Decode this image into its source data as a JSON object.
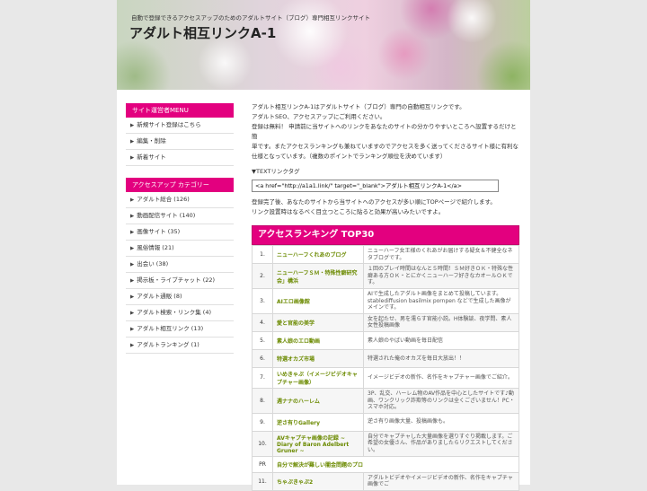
{
  "header": {
    "tagline": "自動で登録できるアクセスアップのためのアダルトサイト（ブログ）専門相互リンクサイト",
    "title": "アダルト相互リンクA-1"
  },
  "admin_menu": {
    "heading": "サイト運営者MENU",
    "items": [
      "新規サイト登録はこちら",
      "編集・削除",
      "新着サイト"
    ]
  },
  "categories": {
    "heading": "アクセスアップ カテゴリー",
    "items": [
      "アダルト総合 (126)",
      "動画配信サイト (140)",
      "画像サイト (35)",
      "風俗情報 (21)",
      "出会い (38)",
      "掲示板・ライブチャット (22)",
      "アダルト通販 (8)",
      "アダルト検索・リンク集 (4)",
      "アダルト相互リンク (13)",
      "アダルトランキング (1)"
    ]
  },
  "main": {
    "intro_lines": [
      "アダルト相互リンクA-1はアダルトサイト（ブログ）専門の自動相互リンクです。",
      "アダルトSEO、アクセスアップにご利用ください。",
      "登録は無料！ 申請前に当サイトへのリンクをあなたのサイトの分かりやすいところへ設置するだけと簡",
      "単です。またアクセスランキングも兼ねていますのでアクセスを多く送ってくださるサイト様に有利な",
      "仕様となっています。（複数のポイントでランキング順位を決めています）"
    ],
    "text_link_label": "▼TEXTリンクタグ",
    "link_code": "<a href=\"http://a1a1.link/\" target=\"_blank\">アダルト相互リンクA-1</a>",
    "after_lines": [
      "登録完了後、あなたのサイトから当サイトへのアクセスが多い順にTOPページで紹介します。",
      "リンク設置時はなるべく目立つところに貼ると効果が高いみたいですよ。"
    ]
  },
  "ranking": {
    "heading": "アクセスランキング TOP30",
    "rows": [
      {
        "num": "1.",
        "site": "ニューハーフくれあのブログ",
        "desc": "ニューハーフ女王様のくれあがお届けする疑女＆不健全なネタブログです。"
      },
      {
        "num": "2.",
        "site": "ニューハーフＳＭ・特殊性癖研究会」構浜",
        "desc": "１回のプレイ時間はなんと５時間！ＳＭ好きＯＫ・特殊な性癖ある方ＯＫ・とにかくニューハーフ好きなカオールＯＫです。"
      },
      {
        "num": "3.",
        "site": "AIエロ画像館",
        "desc": "AIで生成したアダルト画像をまとめて投稿しています。stablediffusion basilmix pornpen などで生成した画像がメインです。"
      },
      {
        "num": "4.",
        "site": "愛と官能の美学",
        "desc": "女を起たせ、男を濡らす官能小説。H体験談、夜学問、素人女性投稿画像"
      },
      {
        "num": "5.",
        "site": "素人娘のエロ動画",
        "desc": "素人娘のやばい動画を毎日配信"
      },
      {
        "num": "6.",
        "site": "特選オカズ市場",
        "desc": "特選された俺のオカズを毎日大放出！！"
      },
      {
        "num": "7.",
        "site": "いめきゃぷ（イメージビデオキャプチャー画像）",
        "desc": "イメージビデオの新作、名作をキャプチャー画像でご紹介。"
      },
      {
        "num": "8.",
        "site": "週ナナのハーレム",
        "desc": "3P、乱交、ハーレム物のAV作品を中心としたサイトです♪動画、ワンクリック詐欺等のリンクは全くございません！PC・スマホ対応。"
      },
      {
        "num": "9.",
        "site": "逆さ有りGallery",
        "desc": "逆さ有り画像大量、投稿画像も。"
      },
      {
        "num": "10.",
        "site": "AVキャプチャ画像の記録 ~ Diary of Baron Adelbert Gruner ~",
        "desc": "自分でキャプチャした大量画像を選りすぐり掲載します。ご希望の女優さん、作品がありましたらリクエストしてください。"
      },
      {
        "num": "PR",
        "site": "自分で解決が難しい闇金問題のプロ",
        "desc": ""
      },
      {
        "num": "11.",
        "site": "ちゃぷきゃぷ2",
        "desc": "アダルトビデオやイメージビデオの新作、名作をキャプチャ画像でご"
      }
    ]
  }
}
